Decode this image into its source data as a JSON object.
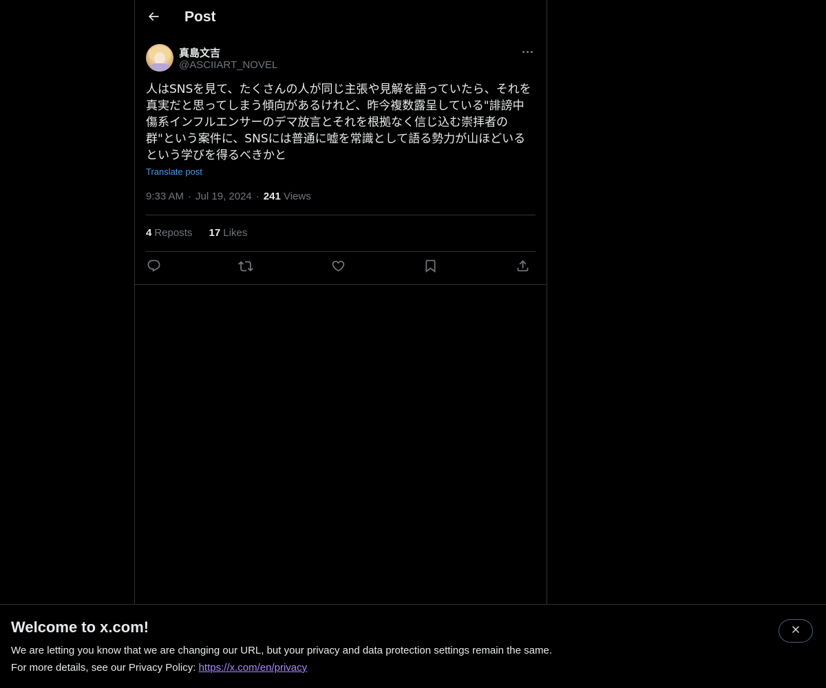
{
  "header": {
    "title": "Post",
    "back_icon": "arrow-left-icon"
  },
  "author": {
    "display_name": "真島文吉",
    "handle": "@ASCIIART_NOVEL",
    "more_icon": "more-horizontal-icon"
  },
  "tweet": {
    "text": "人はSNSを見て、たくさんの人が同じ主張や見解を語っていたら、それを真実だと思ってしまう傾向があるけれど、昨今複数露呈している\"誹謗中傷系インフルエンサーのデマ放言とそれを根拠なく信じ込む崇拝者の群\"という案件に、SNSには普通に嘘を常識として語る勢力が山ほどいるという学びを得るべきかと",
    "translate_label": "Translate post",
    "time": "9:33 AM",
    "date": "Jul 19, 2024",
    "views_count": "241",
    "views_label": "Views",
    "separator": "·"
  },
  "stats": {
    "reposts_count": "4",
    "reposts_label": "Reposts",
    "likes_count": "17",
    "likes_label": "Likes"
  },
  "actions": [
    {
      "name": "reply",
      "icon": "reply-icon"
    },
    {
      "name": "repost",
      "icon": "repost-icon"
    },
    {
      "name": "like",
      "icon": "heart-icon"
    },
    {
      "name": "bookmark",
      "icon": "bookmark-icon"
    },
    {
      "name": "share",
      "icon": "share-icon"
    }
  ],
  "banner": {
    "title": "Welcome to x.com!",
    "line1": "We are letting you know that we are changing our URL, but your privacy and data protection settings remain the same.",
    "line2_prefix": "For more details, see our Privacy Policy: ",
    "link": "https://x.com/en/privacy",
    "close_icon": "close-icon"
  },
  "colors": {
    "background": "#000000",
    "text": "#e7e9ea",
    "secondary_text": "#71767b",
    "link": "#4a99e9",
    "border": "#2f3336"
  }
}
